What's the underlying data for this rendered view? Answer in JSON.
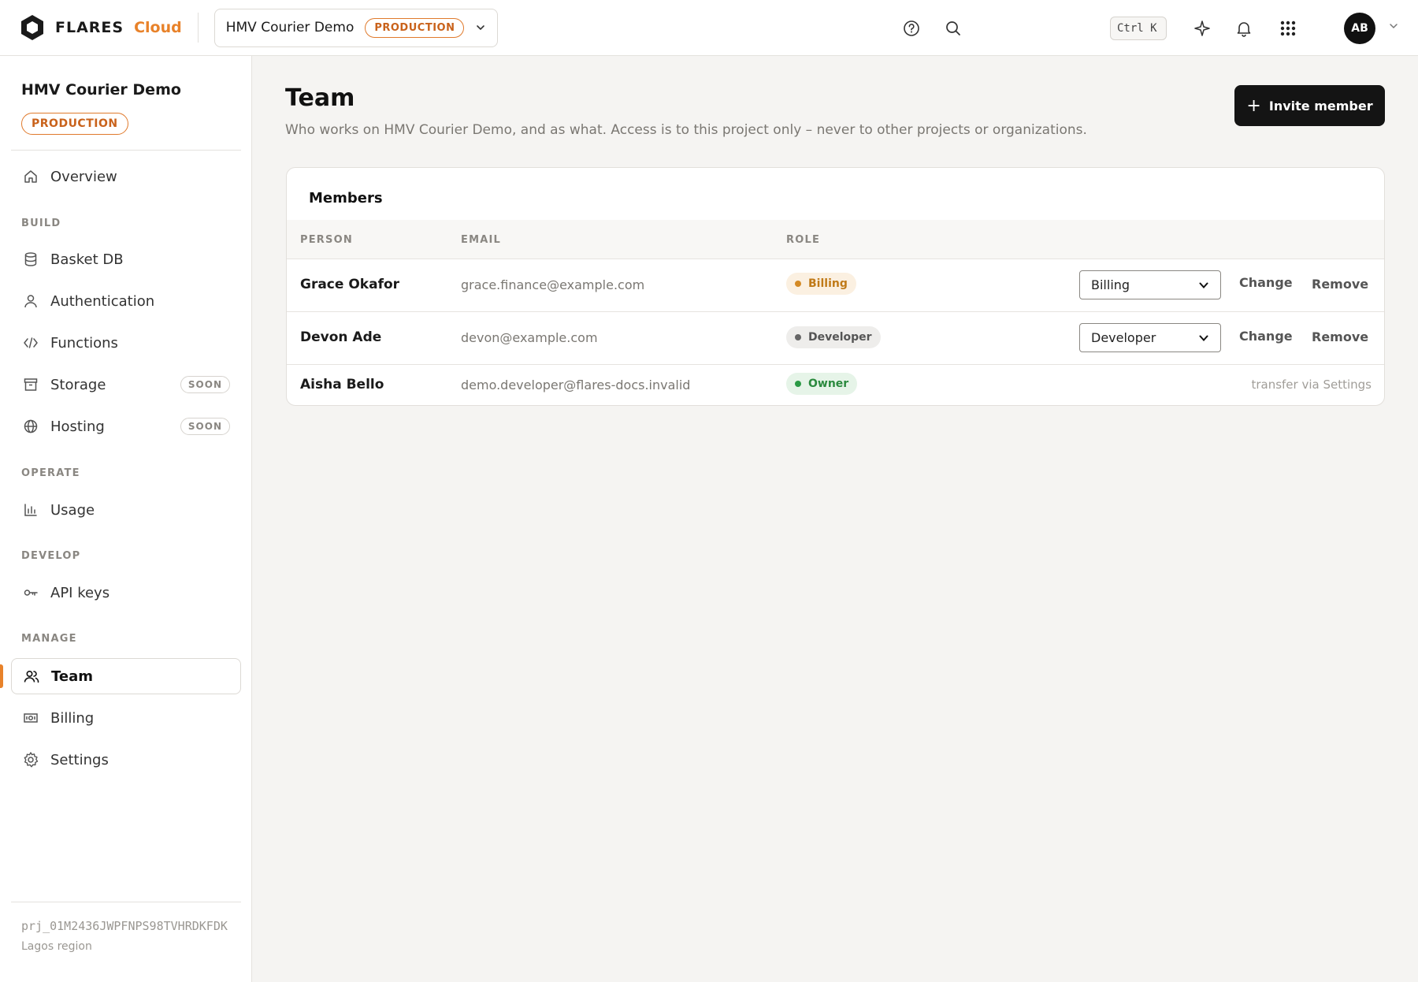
{
  "topbar": {
    "brand_name": "FLARES",
    "brand_suffix": "Cloud",
    "project_name": "HMV Courier Demo",
    "env_badge": "PRODUCTION",
    "shortcut": "Ctrl K",
    "avatar_initials": "AB"
  },
  "sidebar": {
    "project_name": "HMV Courier Demo",
    "env_badge": "PRODUCTION",
    "overview_label": "Overview",
    "sections": {
      "build": "BUILD",
      "operate": "OPERATE",
      "develop": "DEVELOP",
      "manage": "MANAGE"
    },
    "items": {
      "basket_db": "Basket DB",
      "authentication": "Authentication",
      "functions": "Functions",
      "storage": "Storage",
      "hosting": "Hosting",
      "usage": "Usage",
      "api_keys": "API keys",
      "team": "Team",
      "billing": "Billing",
      "settings": "Settings"
    },
    "soon_label": "SOON",
    "project_id": "prj_01M2436JWPFNPS98TVHRDKFDK",
    "region": "Lagos region"
  },
  "main": {
    "title": "Team",
    "subtitle": "Who works on HMV Courier Demo, and as what. Access is to this project only – never to other projects or organizations.",
    "invite_label": "Invite member",
    "members": {
      "title": "Members",
      "columns": [
        "PERSON",
        "EMAIL",
        "ROLE"
      ],
      "rows": [
        {
          "person": "Grace Okafor",
          "email": "grace.finance@example.com",
          "role": "Billing",
          "select_value": "Billing",
          "change": "Change",
          "remove": "Remove"
        },
        {
          "person": "Devon Ade",
          "email": "devon@example.com",
          "role": "Developer",
          "select_value": "Developer",
          "change": "Change",
          "remove": "Remove"
        },
        {
          "person": "Aisha Bello",
          "email": "demo.developer@flares-docs.invalid",
          "role": "Owner",
          "note": "transfer via Settings"
        }
      ]
    }
  },
  "colors": {
    "accent": "#e8822a",
    "billing": "#c07a18",
    "developer": "#555555",
    "owner": "#2b8a3e"
  }
}
